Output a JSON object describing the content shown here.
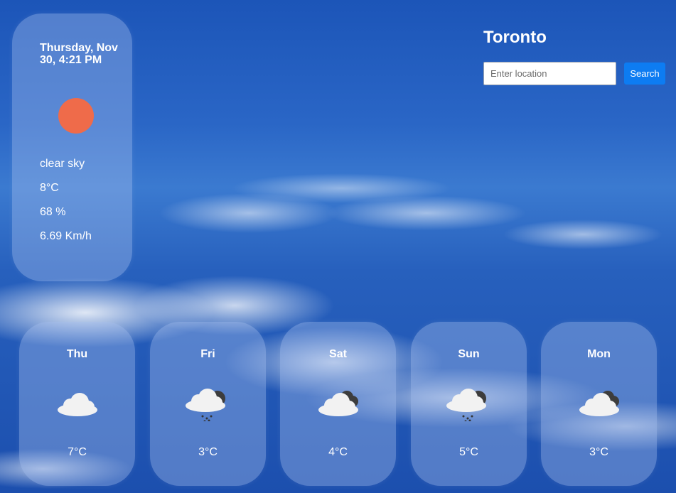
{
  "current": {
    "datetime": "Thursday, Nov 30, 4:21 PM",
    "icon": "sun-icon",
    "description": "clear sky",
    "temperature": "8°C",
    "humidity": "68 %",
    "wind": "6.69 Km/h"
  },
  "header": {
    "city": "Toronto",
    "search_placeholder": "Enter location",
    "search_label": "Search"
  },
  "forecast": [
    {
      "day": "Thu",
      "temp": "7°C",
      "icon": "cloud-icon"
    },
    {
      "day": "Fri",
      "temp": "3°C",
      "icon": "rain-cloud-icon"
    },
    {
      "day": "Sat",
      "temp": "4°C",
      "icon": "dark-clouds-icon"
    },
    {
      "day": "Sun",
      "temp": "5°C",
      "icon": "rain-cloud-icon"
    },
    {
      "day": "Mon",
      "temp": "3°C",
      "icon": "dark-clouds-icon"
    }
  ],
  "colors": {
    "sun": "#ef6b4a",
    "button": "#0d7cf2"
  }
}
